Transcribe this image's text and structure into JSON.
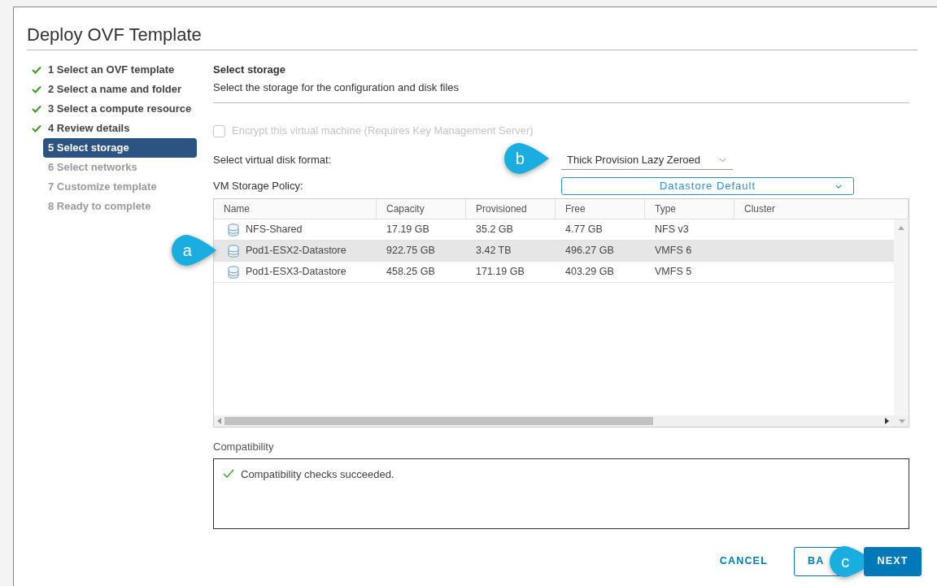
{
  "window": {
    "title": "Deploy OVF Template"
  },
  "steps": [
    {
      "label": "1 Select an OVF template",
      "completed": true,
      "selected": false
    },
    {
      "label": "2 Select a name and folder",
      "completed": true,
      "selected": false
    },
    {
      "label": "3 Select a compute resource",
      "completed": true,
      "selected": false
    },
    {
      "label": "4 Review details",
      "completed": true,
      "selected": false
    },
    {
      "label": "5 Select storage",
      "completed": false,
      "selected": true
    },
    {
      "label": "6 Select networks",
      "completed": false,
      "selected": false
    },
    {
      "label": "7 Customize template",
      "completed": false,
      "selected": false
    },
    {
      "label": "8 Ready to complete",
      "completed": false,
      "selected": false
    }
  ],
  "section": {
    "title": "Select storage",
    "subtitle": "Select the storage for the configuration and disk files"
  },
  "encrypt": {
    "label": "Encrypt this virtual machine (Requires Key Management Server)",
    "checked": false,
    "disabled": true
  },
  "disk_format": {
    "label": "Select virtual disk format:",
    "value": "Thick Provision Lazy Zeroed",
    "callout": "b"
  },
  "storage_policy": {
    "label": "VM Storage Policy:",
    "value": "Datastore Default"
  },
  "table": {
    "columns": [
      "Name",
      "Capacity",
      "Provisioned",
      "Free",
      "Type",
      "Cluster"
    ],
    "rows": [
      {
        "cells": [
          "NFS-Shared",
          "17.19 GB",
          "35.2 GB",
          "4.77 GB",
          "NFS v3"
        ],
        "selected": false
      },
      {
        "cells": [
          "Pod1-ESX2-Datastore",
          "922.75 GB",
          "3.42 TB",
          "496.27 GB",
          "VMFS 6"
        ],
        "selected": true,
        "callout": "a"
      },
      {
        "cells": [
          "Pod1-ESX3-Datastore",
          "458.25 GB",
          "171.19 GB",
          "403.29 GB",
          "VMFS 5"
        ],
        "selected": false
      }
    ]
  },
  "compatibility": {
    "label": "Compatibility",
    "message": "Compatibility checks succeeded."
  },
  "buttons": [
    {
      "label": "CANCEL",
      "kind": "link"
    },
    {
      "label": "BA",
      "kind": "outline",
      "callout": "c"
    },
    {
      "label": "NEXT",
      "kind": "primary"
    }
  ]
}
